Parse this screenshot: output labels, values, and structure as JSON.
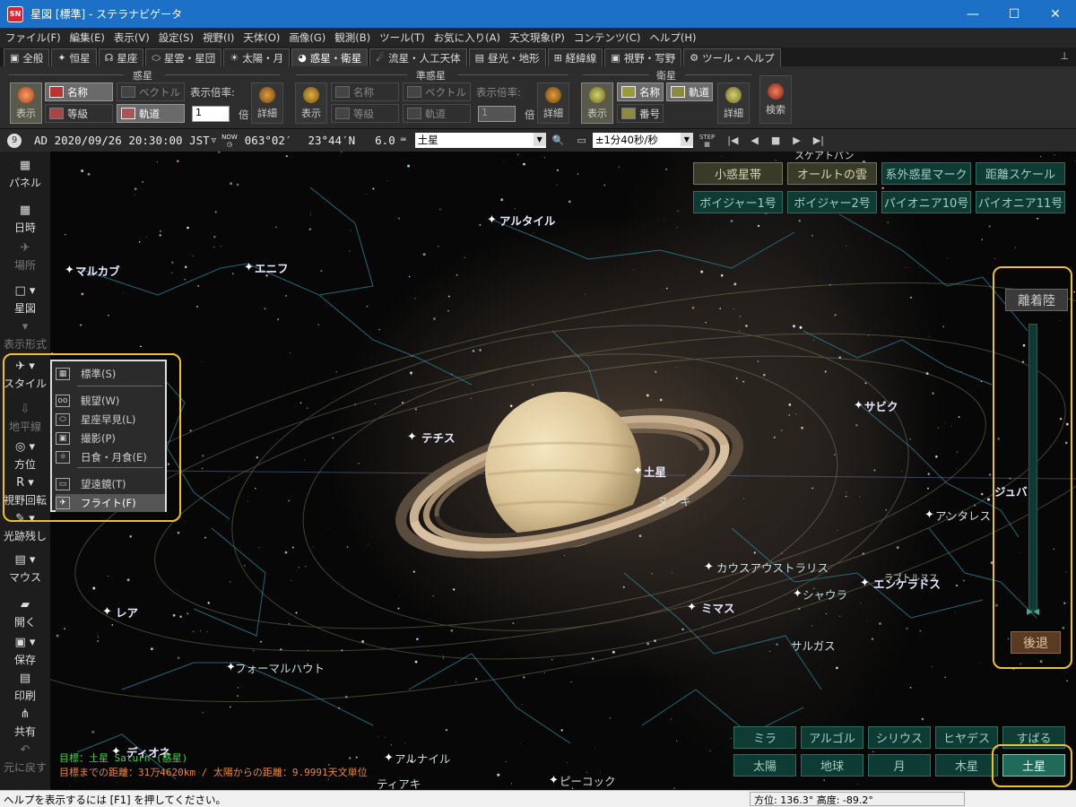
{
  "window": {
    "title": "星図 [標準] - ステラナビゲータ",
    "app_icon": "SN",
    "controls": [
      "—",
      "☐",
      "✕"
    ]
  },
  "menu": [
    "ファイル(F)",
    "編集(E)",
    "表示(V)",
    "設定(S)",
    "視野(I)",
    "天体(O)",
    "画像(G)",
    "観測(B)",
    "ツール(T)",
    "お気に入り(A)",
    "天文現象(P)",
    "コンテンツ(C)",
    "ヘルプ(H)"
  ],
  "tabs": [
    {
      "icon": "▣",
      "label": "全般"
    },
    {
      "icon": "✦",
      "label": "恒星"
    },
    {
      "icon": "☊",
      "label": "星座"
    },
    {
      "icon": "⬭",
      "label": "星雲・星団"
    },
    {
      "icon": "☀",
      "label": "太陽・月"
    },
    {
      "icon": "◕",
      "label": "惑星・衛星"
    },
    {
      "icon": "☄",
      "label": "流星・人工天体"
    },
    {
      "icon": "▤",
      "label": "昼光・地形"
    },
    {
      "icon": "⊞",
      "label": "経緯線"
    },
    {
      "icon": "▣",
      "label": "視野・写野"
    },
    {
      "icon": "⚙",
      "label": "ツール・ヘルプ"
    }
  ],
  "ribbon": {
    "groups": [
      "惑星",
      "準惑星",
      "衛星"
    ],
    "planet": {
      "show": "表示",
      "name": "名称",
      "magnitude": "等級",
      "vector": "ベクトル",
      "orbit": "軌道",
      "scale_label": "表示倍率:",
      "scale_value": "1",
      "times": "倍",
      "detail": "詳細"
    },
    "dwarf": {
      "show": "表示",
      "name": "名称",
      "magnitude": "等級",
      "vector": "ベクトル",
      "orbit": "軌道",
      "scale_label": "表示倍率:",
      "scale_value": "1",
      "times": "倍",
      "detail": "詳細"
    },
    "satellite": {
      "show": "表示",
      "name": "名称",
      "orbit": "軌道",
      "number": "番号",
      "detail": "詳細",
      "search": "検索"
    }
  },
  "infobar": {
    "moon_age": "9",
    "datetime": "AD 2020/09/26 20:30:00 JST",
    "tz_mark": "▽",
    "now_label": "NOW",
    "longitude": "063°02′",
    "latitude": "23°44′N",
    "altitude": "6.0",
    "target": "土星",
    "rate": "±1分40秒/秒",
    "step_label": "STEP"
  },
  "leftbar": [
    {
      "icon": "▦",
      "label": "パネル"
    },
    {
      "icon": "▦",
      "label": "日時"
    },
    {
      "icon": "✈",
      "label": "場所"
    },
    {
      "icon": "□ ▾",
      "label": "星図"
    },
    {
      "icon": "▾",
      "label": "表示形式"
    },
    {
      "icon": "✈ ▾",
      "label": "スタイル"
    },
    {
      "icon": "⇩",
      "label": "地平線"
    },
    {
      "icon": "◎ ▾",
      "label": "方位"
    },
    {
      "icon": "R ▾",
      "label": "視野回転"
    },
    {
      "icon": "✎ ▾",
      "label": "光跡残し"
    },
    {
      "icon": "▤ ▾",
      "label": "マウス"
    },
    {
      "icon": "▰",
      "label": "開く"
    },
    {
      "icon": "▣ ▾",
      "label": "保存"
    },
    {
      "icon": "▤",
      "label": "印刷"
    },
    {
      "icon": "⋔",
      "label": "共有"
    },
    {
      "icon": "↶",
      "label": "元に戻す"
    }
  ],
  "style_menu": [
    {
      "icon": "▦",
      "label": "標準(S)"
    },
    {
      "icon": "oo",
      "label": "観望(W)"
    },
    {
      "icon": "⬭",
      "label": "星座早見(L)"
    },
    {
      "icon": "▣",
      "label": "撮影(P)"
    },
    {
      "icon": "☼",
      "label": "日食・月食(E)"
    },
    {
      "icon": "▭",
      "label": "望遠鏡(T)"
    },
    {
      "icon": "✈",
      "label": "フライト(F)"
    }
  ],
  "top_buttons": [
    "小惑星帯",
    "オールトの雲",
    "系外惑星マーク",
    "距離スケール",
    "ボイジャー1号",
    "ボイジャー2号",
    "パイオニア10号",
    "パイオニア11号"
  ],
  "flight": {
    "up": "離着陸",
    "down": "後退"
  },
  "bottom_buttons": [
    "ミラ",
    "アルゴル",
    "シリウス",
    "ヒヤデス",
    "すばる",
    "太陽",
    "地球",
    "月",
    "木星",
    "土星"
  ],
  "labels": {
    "star": [
      "アルタイル",
      "マルカブ",
      "エニフ",
      "サビク",
      "ジュバ",
      "アンタレス",
      "カウスアウストラリス",
      "ヌンキ",
      "シャウラ",
      "サルガス",
      "フォーマルハウト",
      "アルナイル",
      "ピーコック",
      "ラブトルヌス",
      "スケアトパン"
    ],
    "moon": [
      "テチス",
      "土星",
      "エンケラドス",
      "ミマス",
      "レア",
      "ディオネ",
      "ティアキ"
    ]
  },
  "readout": {
    "target_line": "目標：土星 Saturn (惑星)",
    "distance_line": "目標までの距離：31万4620km / 太陽からの距離：9.9991天文単位"
  },
  "status": {
    "help": "ヘルプを表示するには [F1] を押してください。",
    "position": "方位: 136.3° 高度: -89.2°"
  },
  "colors": {
    "titlebar": "#1c70c6",
    "highlight": "#f0c02a",
    "button_green": "#0e3b33",
    "readout_green": "#3fd43f",
    "readout_orange": "#e8883a"
  }
}
